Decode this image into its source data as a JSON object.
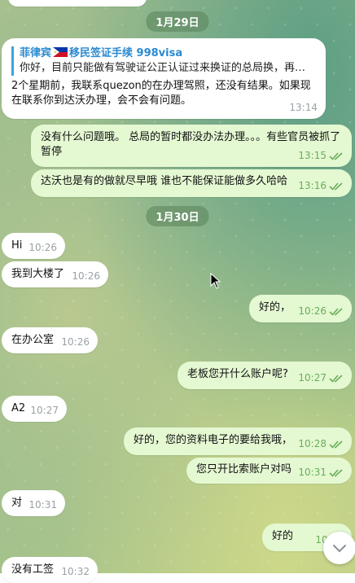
{
  "dates": {
    "jan29": "1月29日",
    "jan30": "1月30日"
  },
  "messages": {
    "m1": {
      "reply_title": "菲律宾",
      "reply_title2": "移民签证手续 998visa",
      "reply_text": "你好，目前只能做有驾驶证公正认证过来换证的总局换，再者...",
      "text": "2个星期前，我联系quezon的在办理驾照，还没有结果。如果现在联系你到达沃办理，会不会有问题。",
      "time": "13:14"
    },
    "m2": {
      "text": "没有什么问题哦。 总局的暂时都没办法办理。。。有些官员被抓了 暂停",
      "time": "13:15"
    },
    "m3": {
      "text": "达沃也是有的做就尽早哦  谁也不能保证能做多久哈哈",
      "time": "13:16"
    },
    "m4": {
      "text": "Hi",
      "time": "10:26"
    },
    "m5": {
      "text": "我到大楼了",
      "time": "10:26"
    },
    "m6": {
      "text": "好的，",
      "time": "10:26"
    },
    "m7": {
      "text": "在办公室",
      "time": "10:26"
    },
    "m8": {
      "text": "老板您开什么账户呢?",
      "time": "10:27"
    },
    "m9": {
      "text": "A2",
      "time": "10:27"
    },
    "m10": {
      "text": "好的，您的资料电子的要给我哦，",
      "time": "10:28"
    },
    "m11": {
      "text": "您只开比索账户对吗",
      "time": "10:31"
    },
    "m12": {
      "text": "对",
      "time": "10:31"
    },
    "m13": {
      "text": "好的",
      "time": "10:31"
    },
    "m14": {
      "text": "没有工签",
      "time": "10:32"
    }
  },
  "colors": {
    "outgoing": "#e4f8d2",
    "incoming": "#ffffff",
    "accent": "#3aa3e0",
    "check": "#6aae5a"
  }
}
